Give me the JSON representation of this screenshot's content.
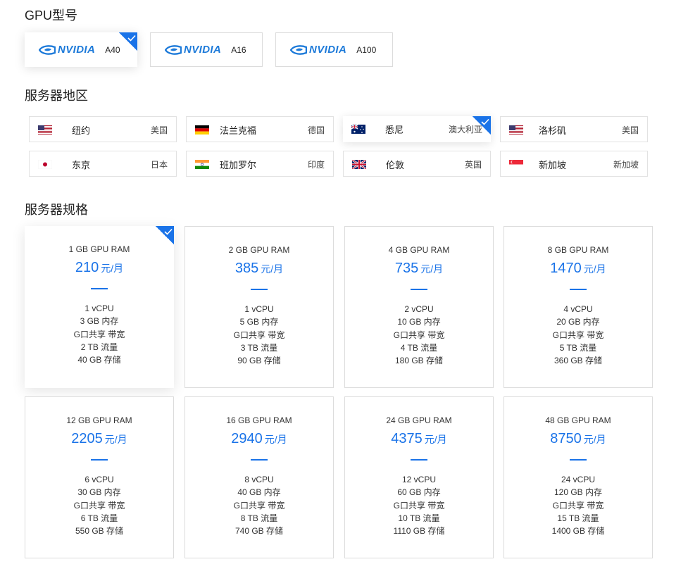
{
  "gpu_section": {
    "title": "GPU型号",
    "brand": "NVIDIA",
    "models": [
      {
        "name": "A40",
        "selected": true
      },
      {
        "name": "A16",
        "selected": false
      },
      {
        "name": "A100",
        "selected": false
      }
    ]
  },
  "region_section": {
    "title": "服务器地区",
    "regions": [
      {
        "city": "纽约",
        "country": "美国",
        "flag": "us-flag",
        "selected": false
      },
      {
        "city": "法兰克福",
        "country": "德国",
        "flag": "de-flag",
        "selected": false
      },
      {
        "city": "悉尼",
        "country": "澳大利亚",
        "flag": "au-flag",
        "selected": true
      },
      {
        "city": "洛杉矶",
        "country": "美国",
        "flag": "us-flag",
        "selected": false
      },
      {
        "city": "东京",
        "country": "日本",
        "flag": "jp-flag",
        "selected": false
      },
      {
        "city": "班加罗尔",
        "country": "印度",
        "flag": "in-flag",
        "selected": false
      },
      {
        "city": "伦敦",
        "country": "英国",
        "flag": "gb-flag",
        "selected": false
      },
      {
        "city": "新加坡",
        "country": "新加坡",
        "flag": "sg-flag",
        "selected": false
      }
    ]
  },
  "plan_section": {
    "title": "服务器规格",
    "price_unit": "元/月",
    "plans": [
      {
        "title": "1 GB GPU RAM",
        "price": "210",
        "selected": true,
        "specs": [
          "1 vCPU",
          "3 GB 内存",
          "G口共享 带宽",
          "2 TB 流量",
          "40 GB 存储"
        ]
      },
      {
        "title": "2 GB GPU RAM",
        "price": "385",
        "selected": false,
        "specs": [
          "1 vCPU",
          "5 GB 内存",
          "G口共享 带宽",
          "3 TB 流量",
          "90 GB 存储"
        ]
      },
      {
        "title": "4 GB GPU RAM",
        "price": "735",
        "selected": false,
        "specs": [
          "2 vCPU",
          "10 GB 内存",
          "G口共享 带宽",
          "4 TB 流量",
          "180 GB 存储"
        ]
      },
      {
        "title": "8 GB GPU RAM",
        "price": "1470",
        "selected": false,
        "specs": [
          "4 vCPU",
          "20 GB 内存",
          "G口共享 带宽",
          "5 TB 流量",
          "360 GB 存储"
        ]
      },
      {
        "title": "12 GB GPU RAM",
        "price": "2205",
        "selected": false,
        "specs": [
          "6 vCPU",
          "30 GB 内存",
          "G口共享 带宽",
          "6 TB 流量",
          "550 GB 存储"
        ]
      },
      {
        "title": "16 GB GPU RAM",
        "price": "2940",
        "selected": false,
        "specs": [
          "8 vCPU",
          "40 GB 内存",
          "G口共享 带宽",
          "8 TB 流量",
          "740 GB 存储"
        ]
      },
      {
        "title": "24 GB GPU RAM",
        "price": "4375",
        "selected": false,
        "specs": [
          "12 vCPU",
          "60 GB 内存",
          "G口共享 带宽",
          "10 TB 流量",
          "1110 GB 存储"
        ]
      },
      {
        "title": "48 GB GPU RAM",
        "price": "8750",
        "selected": false,
        "specs": [
          "24 vCPU",
          "120 GB 内存",
          "G口共享 带宽",
          "15 TB 流量",
          "1400 GB 存储"
        ]
      }
    ]
  },
  "colors": {
    "accent": "#1a73e8",
    "brand": "#1d7ad9",
    "border": "#dcdcdc"
  }
}
